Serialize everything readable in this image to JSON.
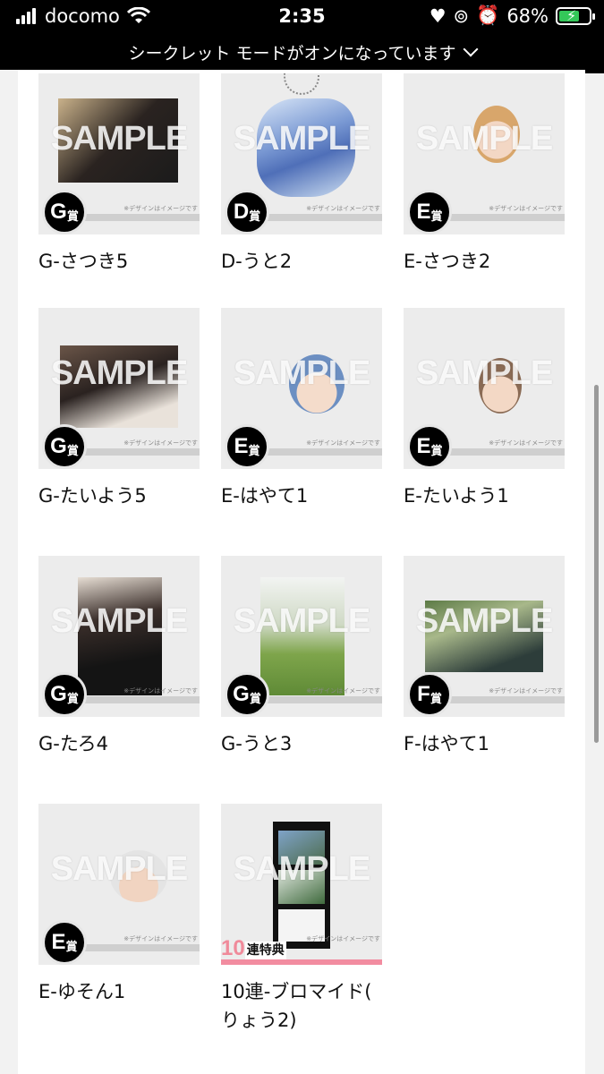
{
  "status_bar": {
    "carrier": "docomo",
    "time": "2:35",
    "battery_percent": "68%"
  },
  "incognito_banner": {
    "text": "シークレット モードがオンになっています"
  },
  "items": [
    {
      "label": "G-さつき5",
      "rank_letter": "G",
      "rank_suffix": "賞",
      "note": "※デザインはイメージです",
      "sample": "SAMPLE"
    },
    {
      "label": "D-うと2",
      "rank_letter": "D",
      "rank_suffix": "賞",
      "note": "※デザインはイメージです",
      "sample": "SAMPLE"
    },
    {
      "label": "E-さつき2",
      "rank_letter": "E",
      "rank_suffix": "賞",
      "note": "※デザインはイメージです",
      "sample": "SAMPLE"
    },
    {
      "label": "G-たいよう5",
      "rank_letter": "G",
      "rank_suffix": "賞",
      "note": "※デザインはイメージです",
      "sample": "SAMPLE"
    },
    {
      "label": "E-はやて1",
      "rank_letter": "E",
      "rank_suffix": "賞",
      "note": "※デザインはイメージです",
      "sample": "SAMPLE"
    },
    {
      "label": "E-たいよう1",
      "rank_letter": "E",
      "rank_suffix": "賞",
      "note": "※デザインはイメージです",
      "sample": "SAMPLE"
    },
    {
      "label": "G-たろ4",
      "rank_letter": "G",
      "rank_suffix": "賞",
      "note": "※デザインはイメージです",
      "sample": "SAMPLE"
    },
    {
      "label": "G-うと3",
      "rank_letter": "G",
      "rank_suffix": "賞",
      "note": "※デザインはイメージです",
      "sample": "SAMPLE"
    },
    {
      "label": "F-はやて1",
      "rank_letter": "F",
      "rank_suffix": "賞",
      "note": "※デザインはイメージです",
      "sample": "SAMPLE"
    },
    {
      "label": "E-ゆそん1",
      "rank_letter": "E",
      "rank_suffix": "賞",
      "note": "※デザインはイメージです",
      "sample": "SAMPLE"
    },
    {
      "label_line1": "10連-ブロマイド(",
      "label_line2": "りょう2)",
      "bonus_number": "10",
      "bonus_text": "連特典",
      "note": "※デザインはイメージです",
      "sample": "SAMPLE"
    }
  ]
}
